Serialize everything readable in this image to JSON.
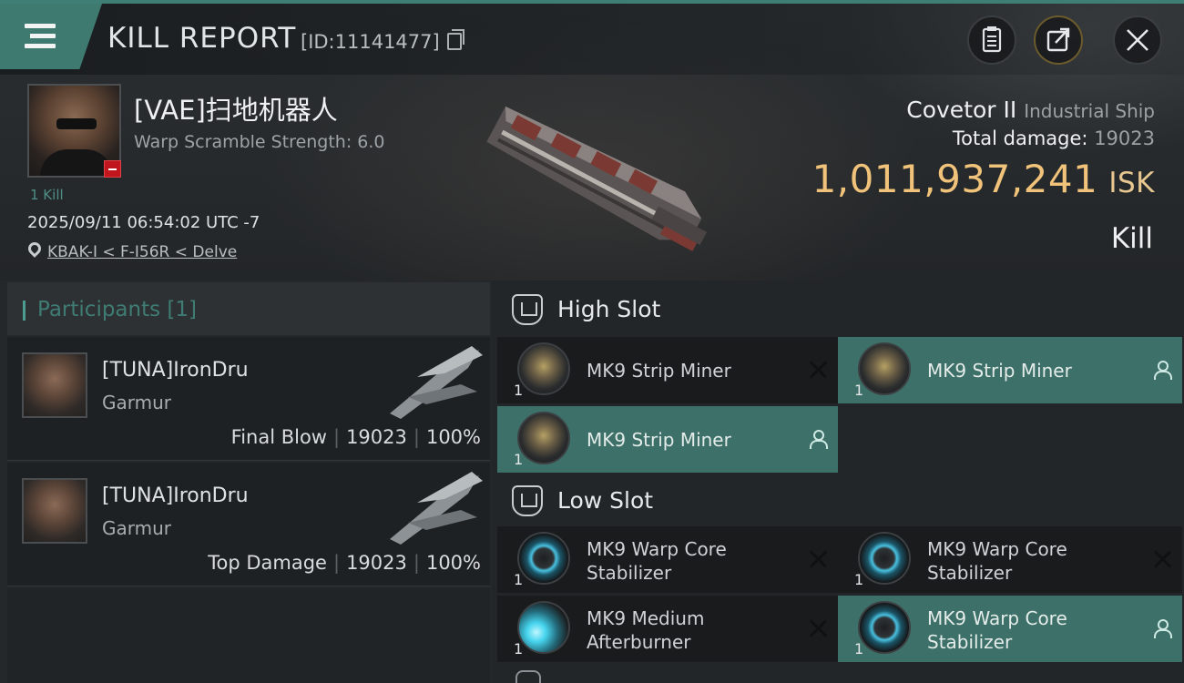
{
  "header": {
    "title": "KILL REPORT",
    "report_id": "[ID:11141477]",
    "icons": [
      "menu-icon",
      "copy-icon",
      "clipboard-icon",
      "share-icon",
      "close-icon"
    ]
  },
  "victim": {
    "name": "[VAE]扫地机器人",
    "warp_scramble": "Warp Scramble Strength: 6.0",
    "kills": "1 Kill",
    "datetime": "2025/09/11 06:54:02 UTC -7",
    "location": "KBAK-I < F-I56R < Delve"
  },
  "ship": {
    "name": "Covetor II",
    "class": "Industrial Ship",
    "total_damage_label": "Total damage:",
    "total_damage": "19023",
    "isk_value": "1,011,937,241",
    "isk_unit": "ISK",
    "result": "Kill"
  },
  "participants": {
    "label": "Participants",
    "count": "[1]",
    "rows": [
      {
        "name": "[TUNA]IronDru",
        "ship": "Garmur",
        "role": "Final Blow",
        "damage": "19023",
        "percent": "100%"
      },
      {
        "name": "[TUNA]IronDru",
        "ship": "Garmur",
        "role": "Top Damage",
        "damage": "19023",
        "percent": "100%"
      }
    ],
    "separator": "|"
  },
  "fitting": {
    "high_slot_label": "High Slot",
    "low_slot_label": "Low Slot",
    "high_slots": [
      {
        "name": "MK9 Strip Miner",
        "qty": "1",
        "state": "destroyed"
      },
      {
        "name": "MK9 Strip Miner",
        "qty": "1",
        "state": "dropped"
      },
      {
        "name": "MK9 Strip Miner",
        "qty": "1",
        "state": "dropped"
      }
    ],
    "low_slots": [
      {
        "name_line1": "MK9 Warp Core",
        "name_line2": "Stabilizer",
        "qty": "1",
        "state": "destroyed"
      },
      {
        "name_line1": "MK9 Warp Core",
        "name_line2": "Stabilizer",
        "qty": "1",
        "state": "destroyed"
      },
      {
        "name_line1": "MK9 Medium",
        "name_line2": "Afterburner",
        "qty": "1",
        "state": "destroyed"
      },
      {
        "name_line1": "MK9 Warp Core",
        "name_line2": "Stabilizer",
        "qty": "1",
        "state": "dropped"
      }
    ]
  },
  "colors": {
    "accent": "#3f7a71",
    "isk": "#f0c27a",
    "dropped_bg": "#3d7068",
    "destroyed_bg": "#191b1d",
    "alert": "#c2161e"
  }
}
